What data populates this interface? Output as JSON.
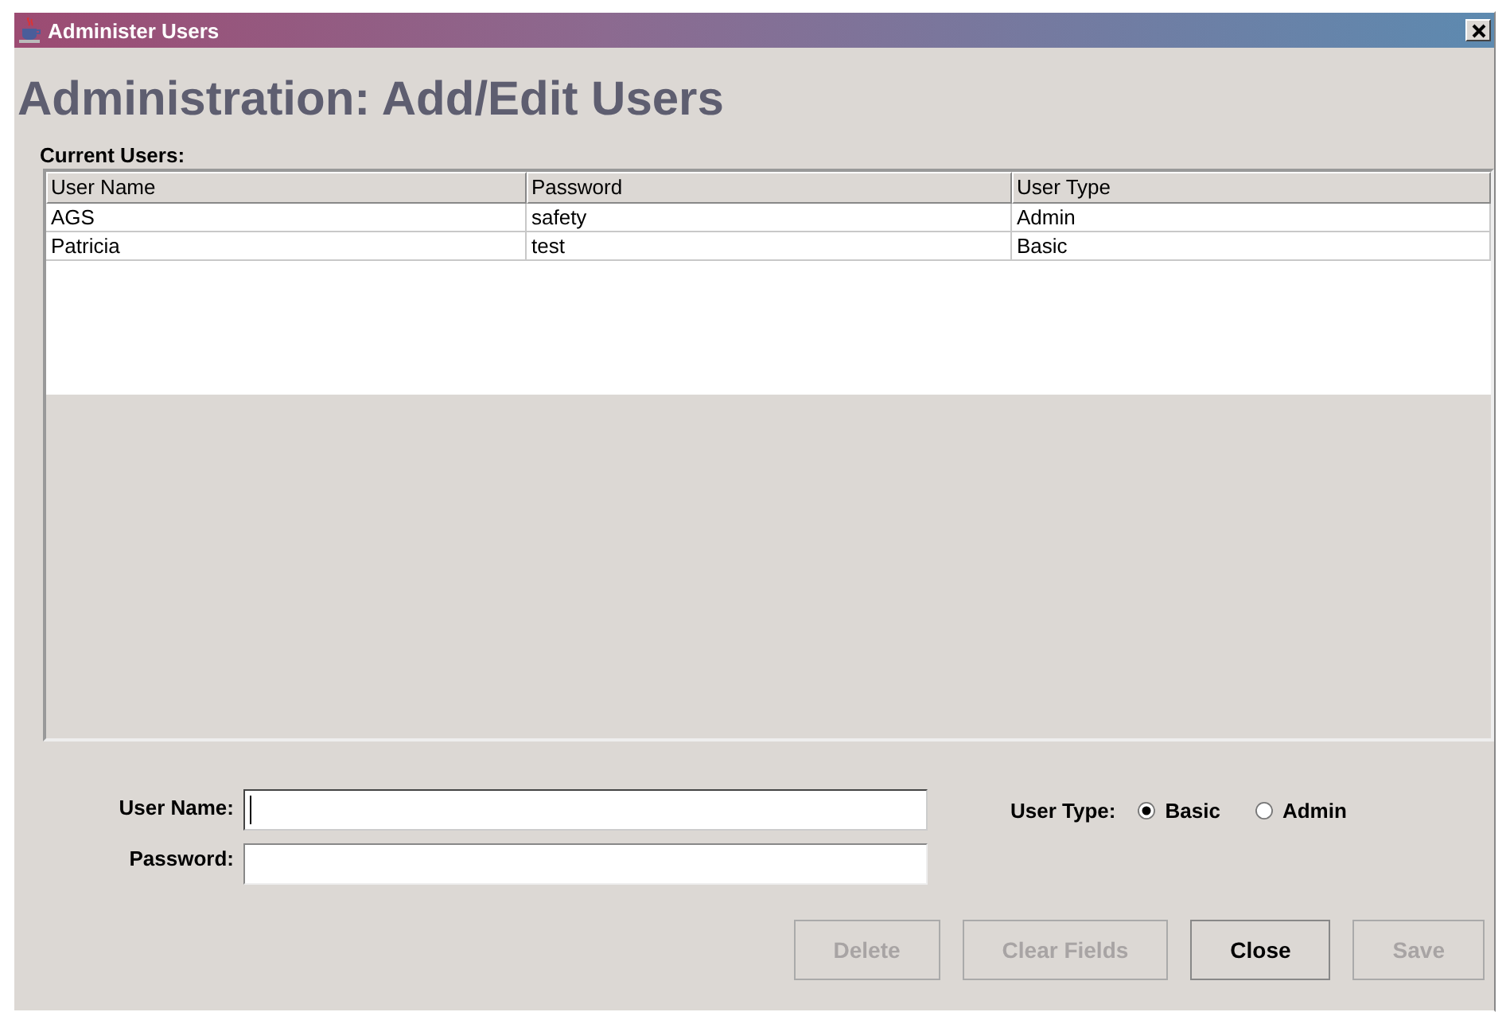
{
  "window": {
    "title": "Administer Users"
  },
  "heading": "Administration: Add/Edit Users",
  "table": {
    "label": "Current Users:",
    "columns": [
      "User Name",
      "Password",
      "User Type"
    ],
    "rows": [
      [
        "AGS",
        "safety",
        "Admin"
      ],
      [
        "Patricia",
        "test",
        "Basic"
      ]
    ]
  },
  "form": {
    "fields": [
      {
        "label": "User Name:",
        "focused": true
      },
      {
        "label": "Password:",
        "focused": false
      }
    ],
    "user_type": {
      "label": "User Type:",
      "options": [
        {
          "label": "Basic",
          "selected": true
        },
        {
          "label": "Admin",
          "selected": false
        }
      ]
    }
  },
  "buttons": [
    {
      "label": "Delete",
      "disabled": true
    },
    {
      "label": "Clear Fields",
      "disabled": true
    },
    {
      "label": "Close",
      "disabled": false
    },
    {
      "label": "Save",
      "disabled": true
    }
  ]
}
